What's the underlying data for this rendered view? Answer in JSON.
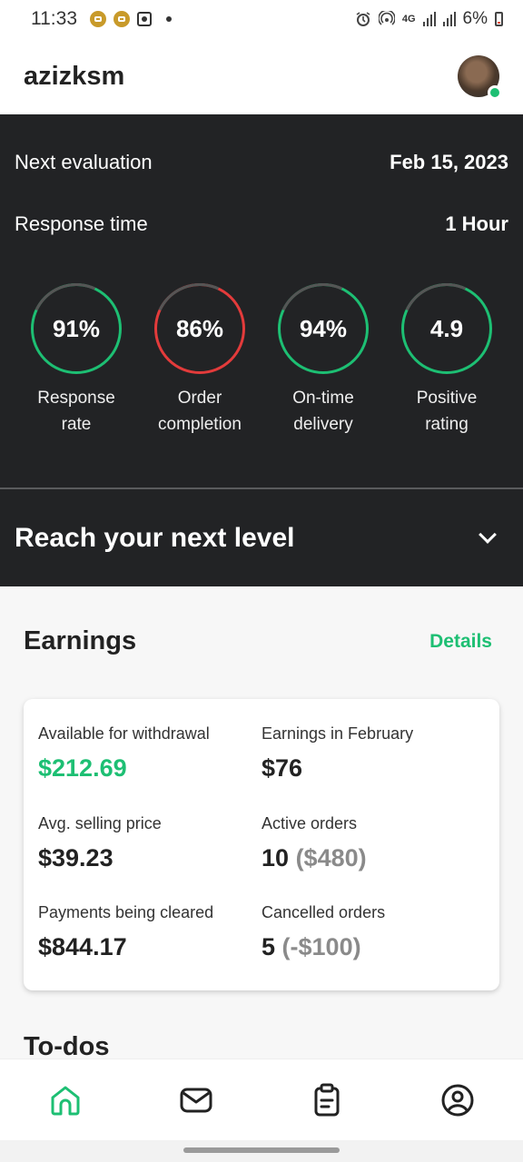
{
  "status_bar": {
    "time": "11:33",
    "network": "4G",
    "battery": "6%"
  },
  "header": {
    "username": "azizksm"
  },
  "summary": {
    "next_evaluation_label": "Next evaluation",
    "next_evaluation_value": "Feb 15, 2023",
    "response_time_label": "Response time",
    "response_time_value": "1 Hour"
  },
  "metrics": [
    {
      "value": "91%",
      "label_line1": "Response",
      "label_line2": "rate",
      "color": "#1dbf73"
    },
    {
      "value": "86%",
      "label_line1": "Order",
      "label_line2": "completion",
      "color": "#e33b3b"
    },
    {
      "value": "94%",
      "label_line1": "On-time",
      "label_line2": "delivery",
      "color": "#1dbf73"
    },
    {
      "value": "4.9",
      "label_line1": "Positive",
      "label_line2": "rating",
      "color": "#1dbf73"
    }
  ],
  "next_level": {
    "title": "Reach your next level"
  },
  "earnings": {
    "title": "Earnings",
    "details_label": "Details",
    "available_label": "Available for withdrawal",
    "available_value": "$212.69",
    "february_label": "Earnings in February",
    "february_value": "$76",
    "avg_price_label": "Avg. selling price",
    "avg_price_value": "$39.23",
    "active_orders_label": "Active orders",
    "active_orders_count": "10",
    "active_orders_amount": "($480)",
    "payments_cleared_label": "Payments being cleared",
    "payments_cleared_value": "$844.17",
    "cancelled_orders_label": "Cancelled orders",
    "cancelled_orders_count": "5",
    "cancelled_orders_amount": "(-$100)"
  },
  "todos": {
    "title": "To-dos"
  },
  "bottom_nav": {
    "items": [
      "home-icon",
      "inbox-icon",
      "orders-icon",
      "profile-icon"
    ],
    "active_color": "#1dbf73"
  },
  "colors": {
    "accent": "#1dbf73",
    "warning": "#e33b3b",
    "dark_panel": "#222325"
  }
}
